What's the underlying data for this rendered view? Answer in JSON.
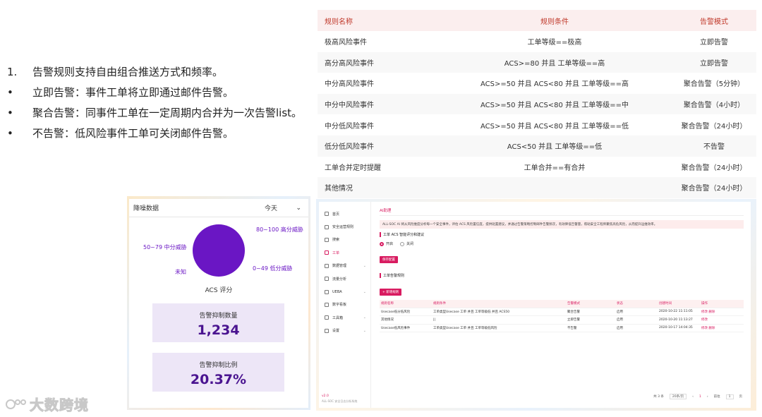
{
  "bullets": [
    {
      "marker": "1.",
      "text": "告警规则支持自由组合推送方式和频率。"
    },
    {
      "marker": "•",
      "text": "立即告警：事件工单将立即通过邮件告警。"
    },
    {
      "marker": "•",
      "text": "聚合告警：同事件工单在一定周期内合并为一次告警list。"
    },
    {
      "marker": "•",
      "text": "不告警：低风险事件工单可关闭邮件告警。"
    }
  ],
  "rules_table": {
    "headers": [
      "规则名称",
      "规则条件",
      "告警模式"
    ],
    "rows": [
      [
        "极高风险事件",
        "工单等级==极高",
        "立即告警"
      ],
      [
        "高分高风险事件",
        "ACS>=80 并且 工单等级==高",
        "立即告警"
      ],
      [
        "中分高风险事件",
        "ACS>=50 并且 ACS<80 并且 工单等级==高",
        "聚合告警（5分钟）"
      ],
      [
        "中分中风险事件",
        "ACS>=50 并且 ACS<80 并且 工单等级==中",
        "聚合告警（4小时）"
      ],
      [
        "中分低风险事件",
        "ACS>=50 并且 ACS<80 并且 工单等级==低",
        "聚合告警（24小时）"
      ],
      [
        "低分低风险事件",
        "ACS<50 并且 工单等级==低",
        "不告警"
      ],
      [
        "工单合并定时提醒",
        "工单合并==有合并",
        "聚合告警（24小时）"
      ],
      [
        "其他情况",
        "",
        "聚合告警（24小时）"
      ]
    ]
  },
  "noise_card": {
    "title": "降噪数据",
    "range_select": "今天",
    "labels": {
      "high": "80~100 高分威胁",
      "mid": "50~79 中分威胁",
      "low": "0~49 低分威胁",
      "unknown": "未知"
    },
    "pie_color": "#6a16c4",
    "caption": "ACS 评分",
    "stat1_label": "告警抑制数量",
    "stat1_value": "1,234",
    "stat2_label": "告警抑制比例",
    "stat2_value": "20.37%"
  },
  "watermark": "大数跨境",
  "app": {
    "menu": [
      {
        "label": "首页",
        "active": false,
        "chev": false
      },
      {
        "label": "安全运营规则",
        "active": false,
        "chev": false
      },
      {
        "label": "搜索",
        "active": false,
        "chev": false
      },
      {
        "label": "工单",
        "active": true,
        "chev": false
      },
      {
        "label": "数据管理",
        "active": false,
        "chev": true
      },
      {
        "label": "流量分析",
        "active": false,
        "chev": false
      },
      {
        "label": "UEBA",
        "active": false,
        "chev": true
      },
      {
        "label": "数字看板",
        "active": false,
        "chev": false
      },
      {
        "label": "工具箱",
        "active": false,
        "chev": true
      },
      {
        "label": "设置",
        "active": false,
        "chev": true
      }
    ],
    "version": "v2.0",
    "footer": "ALL-SOC 安全日志分析系统",
    "breadcrumb": "AI助理",
    "notice": "ALL-SOC AI 将从风险维度分析每一个安全事件，评估 ACS 风险置信度，提供处置建议，并通过告警策略控制邮件告警频次，有效降低告警量，帮助安全工程师聚焦高危风险，从而提升运维效率。",
    "section1": "工单 ACS 智能评分和建议",
    "radio_on": "开启",
    "radio_off": "关闭",
    "save_btn": "保存配置",
    "section2": "工单告警规则",
    "add_btn": "+ 新增规则",
    "table_headers": [
      "规则名称",
      "规则条件",
      "告警模式",
      "状态",
      "创建时间",
      "操作"
    ],
    "table_rows": [
      [
        "Usecase低分低风险",
        "工单类型Usecase 工单 并且 工单等级低 并且 ACS50",
        "聚合告警",
        "启用",
        "2020-10-22 11:11:05",
        "修改  删除"
      ],
      [
        "其他情况",
        "||",
        "立即告警",
        "启用",
        "2020-10-20 11:13:27",
        "修改"
      ],
      [
        "Usecase低风险事件",
        "工单类型Usecase 工单 并且 工单等级低风险",
        "不告警",
        "启用",
        "2020-10-17 14:04:35",
        "修改  删除"
      ]
    ],
    "pager": {
      "total": "共 3 条",
      "size": "20条/页",
      "page": "1",
      "goto_label": "前往",
      "goto_value": "1",
      "goto_unit": "页"
    }
  }
}
